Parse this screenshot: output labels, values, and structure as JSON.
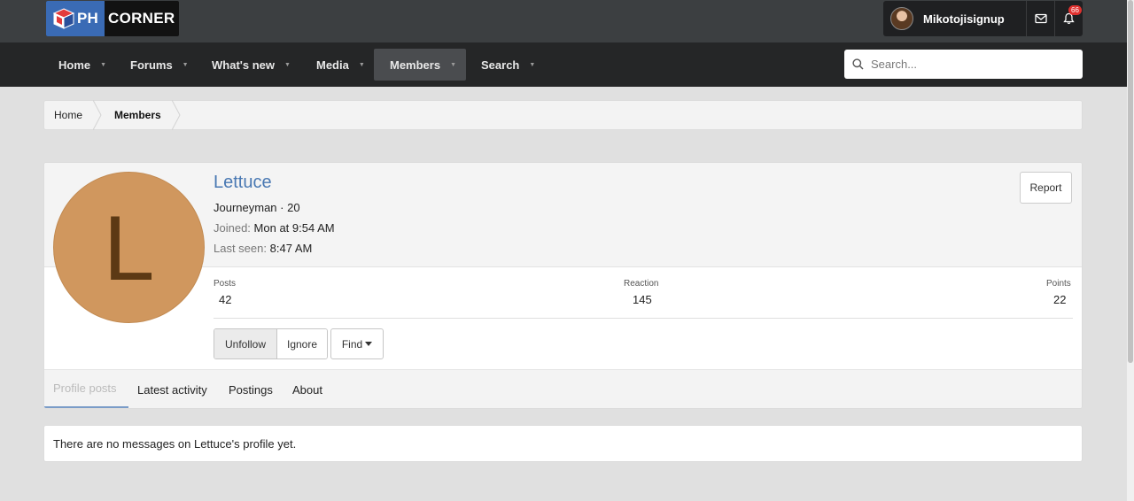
{
  "header": {
    "logo_left": "PH",
    "logo_right": "CORNER",
    "username": "Mikotojisignup",
    "notification_count": "66"
  },
  "nav": {
    "items": [
      {
        "label": "Home"
      },
      {
        "label": "Forums"
      },
      {
        "label": "What's new"
      },
      {
        "label": "Media"
      },
      {
        "label": "Members"
      },
      {
        "label": "Search"
      }
    ],
    "active": "Members",
    "search_placeholder": "Search..."
  },
  "breadcrumb": {
    "items": [
      "Home",
      "Members"
    ]
  },
  "profile": {
    "initial": "L",
    "avatar_color": "#d0975e",
    "name": "Lettuce",
    "title_line": "Journeyman · 20",
    "joined_label": "Joined:",
    "joined_value": "Mon at 9:54 AM",
    "last_seen_label": "Last seen:",
    "last_seen_value": "8:47 AM",
    "report_label": "Report",
    "stats": {
      "posts_label": "Posts",
      "posts_value": "42",
      "reaction_label": "Reaction",
      "reaction_value": "145",
      "points_label": "Points",
      "points_value": "22"
    },
    "buttons": {
      "unfollow": "Unfollow",
      "ignore": "Ignore",
      "find": "Find"
    },
    "tabs": [
      "Profile posts",
      "Latest activity",
      "Postings",
      "About"
    ],
    "active_tab": "Profile posts"
  },
  "messages": {
    "empty_text": "There are no messages on Lettuce's profile yet."
  },
  "colors": {
    "accent_link": "#4a79b3",
    "header_bg": "#3c3f41",
    "nav_bg": "#252627",
    "badge": "#e0312f"
  }
}
